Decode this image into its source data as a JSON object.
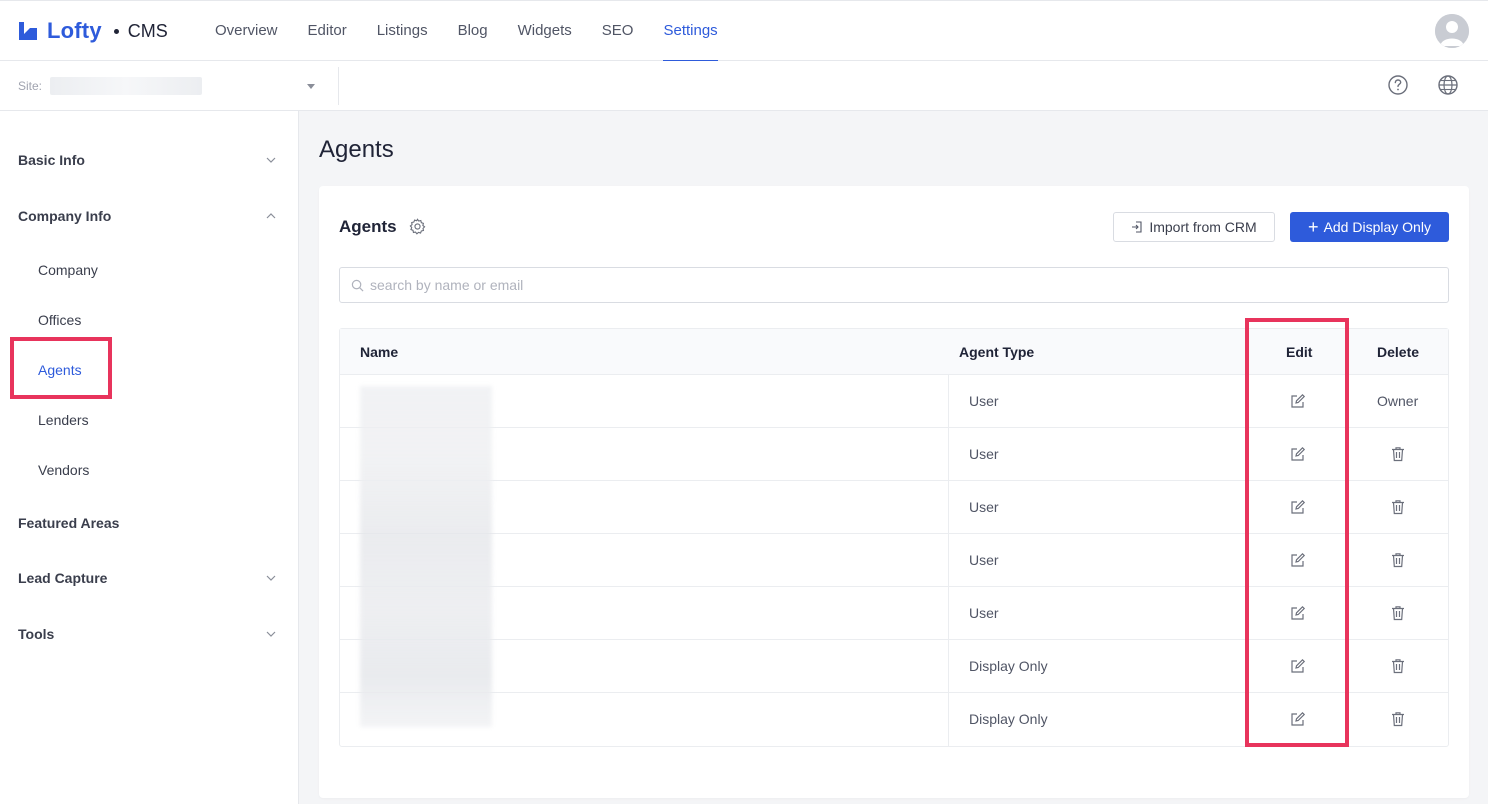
{
  "app": {
    "brand": "Lofty",
    "product": "CMS"
  },
  "nav": {
    "items": [
      {
        "label": "Overview"
      },
      {
        "label": "Editor"
      },
      {
        "label": "Listings"
      },
      {
        "label": "Blog"
      },
      {
        "label": "Widgets"
      },
      {
        "label": "SEO"
      },
      {
        "label": "Settings",
        "active": true
      }
    ]
  },
  "sitebar": {
    "site_label": "Site:"
  },
  "sidebar": {
    "basic_info": "Basic Info",
    "company_info": "Company Info",
    "company": "Company",
    "offices": "Offices",
    "agents": "Agents",
    "lenders": "Lenders",
    "vendors": "Vendors",
    "featured_areas": "Featured Areas",
    "lead_capture": "Lead Capture",
    "tools": "Tools"
  },
  "main": {
    "page_title": "Agents",
    "card_title": "Agents",
    "import_button": "Import from CRM",
    "add_button": "Add Display Only",
    "search_placeholder": "search by name or email",
    "search_value": ""
  },
  "table": {
    "columns": [
      "Name",
      "Agent Type",
      "Edit",
      "Delete"
    ],
    "rows": [
      {
        "type": "User",
        "delete": "Owner"
      },
      {
        "type": "User",
        "delete": "trash-icon"
      },
      {
        "type": "User",
        "delete": "trash-icon"
      },
      {
        "type": "User",
        "delete": "trash-icon"
      },
      {
        "type": "User",
        "delete": "trash-icon"
      },
      {
        "type": "Display Only",
        "delete": "trash-icon"
      },
      {
        "type": "Display Only",
        "delete": "trash-icon"
      }
    ]
  },
  "colors": {
    "accent": "#2e5bdb",
    "highlight": "#e8345c",
    "text": "#202437"
  }
}
